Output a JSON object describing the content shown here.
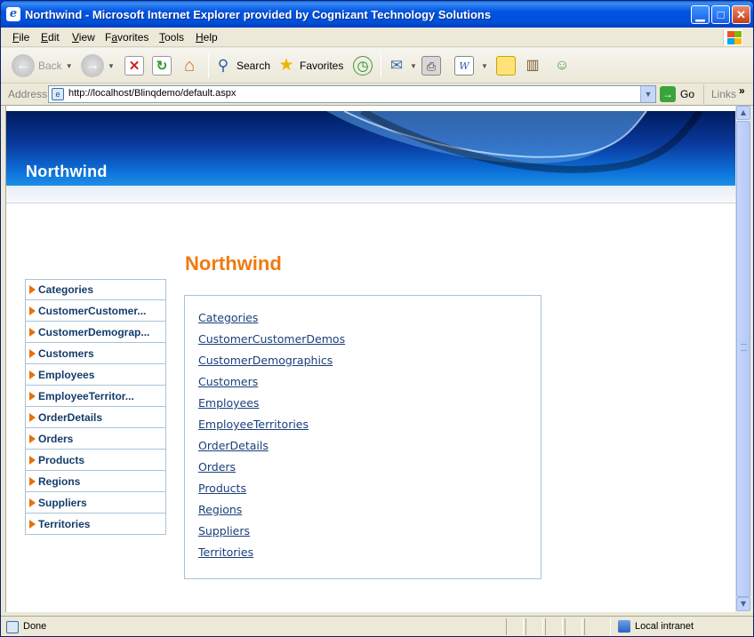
{
  "window": {
    "title": "Northwind - Microsoft Internet Explorer provided by Cognizant Technology Solutions",
    "app_icon": "ie-icon",
    "controls": {
      "minimize": "minimize-icon",
      "maximize": "maximize-icon",
      "close": "close-icon"
    }
  },
  "menu": {
    "items": [
      {
        "label": "File",
        "accel": "F",
        "rest": "ile"
      },
      {
        "label": "Edit",
        "accel": "E",
        "rest": "dit"
      },
      {
        "label": "View",
        "accel": "V",
        "rest": "iew"
      },
      {
        "label": "Favorites",
        "accel": "a",
        "pre": "F",
        "rest": "vorites"
      },
      {
        "label": "Tools",
        "accel": "T",
        "rest": "ools"
      },
      {
        "label": "Help",
        "accel": "H",
        "rest": "elp"
      }
    ]
  },
  "toolbar": {
    "back_label": "Back",
    "search_label": "Search",
    "favorites_label": "Favorites"
  },
  "address": {
    "label": "Address",
    "url": "http://localhost/Blinqdemo/default.aspx",
    "go_label": "Go",
    "links_label": "Links",
    "links_chevron": "»"
  },
  "page": {
    "banner_title": "Northwind",
    "heading": "Northwind",
    "nav_items": [
      "Categories",
      "CustomerCustomer...",
      "CustomerDemograp...",
      "Customers",
      "Employees",
      "EmployeeTerritor...",
      "OrderDetails",
      "Orders",
      "Products",
      "Regions",
      "Suppliers",
      "Territories"
    ],
    "links": [
      "Categories",
      "CustomerCustomerDemos",
      "CustomerDemographics",
      "Customers",
      "Employees",
      "EmployeeTerritories",
      "OrderDetails",
      "Orders",
      "Products",
      "Regions",
      "Suppliers",
      "Territories"
    ]
  },
  "status": {
    "text": "Done",
    "zone": "Local intranet"
  },
  "colors": {
    "accent_orange": "#f07a10",
    "link_blue": "#1a3f7a",
    "nav_text": "#143c6b",
    "titlebar_blue": "#0054e3"
  }
}
